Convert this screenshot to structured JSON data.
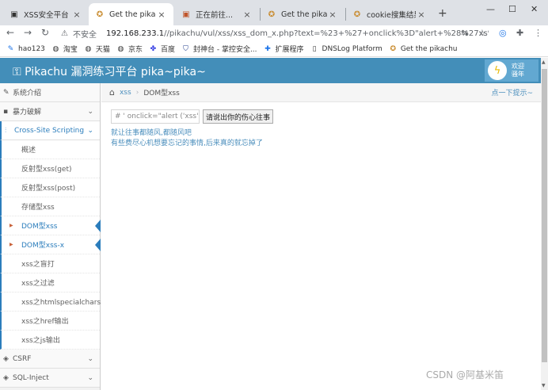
{
  "browser": {
    "tabs": [
      {
        "title": "XSS安全平台",
        "icon": "page-icon"
      },
      {
        "title": "Get the pikachu",
        "icon": "pikachu-icon"
      },
      {
        "title": "正在前往...",
        "icon": "page-icon"
      },
      {
        "title": "Get the pikachu",
        "icon": "pikachu-icon"
      },
      {
        "title": "cookie搜集结果",
        "icon": "cookie-icon"
      }
    ],
    "active_tab": 1,
    "address": {
      "security": "不安全",
      "host": "192.168.233.1",
      "path": "//pikachu/vul/xss/xss_dom_x.php?text=%23+%27+onclick%3D\"alert+%28%27xs%..."
    },
    "bookmarks": [
      {
        "label": "hao123",
        "icon": "hao123-icon"
      },
      {
        "label": "淘宝",
        "icon": "globe-icon"
      },
      {
        "label": "天猫",
        "icon": "globe-icon"
      },
      {
        "label": "京东",
        "icon": "globe-icon"
      },
      {
        "label": "百度",
        "icon": "baidu-icon"
      },
      {
        "label": "封神台 - 掌控安全...",
        "icon": "shield-icon"
      },
      {
        "label": "扩展程序",
        "icon": "puzzle-icon"
      },
      {
        "label": "DNSLog Platform",
        "icon": "page-icon"
      },
      {
        "label": "Get the pikachu",
        "icon": "pikachu-icon"
      }
    ]
  },
  "site": {
    "logo": "Pikachu 漏洞练习平台 pika~pika~",
    "user_greeting_1": "欢迎",
    "user_greeting_2": "骚年"
  },
  "sidebar": {
    "top_items": [
      {
        "label": "系统介绍",
        "icon": "tag-icon"
      },
      {
        "label": "暴力破解",
        "icon": "lock-icon"
      }
    ],
    "open_section": {
      "label": "Cross-Site Scripting",
      "icon": "tree-icon"
    },
    "sub_items": [
      {
        "label": "概述",
        "active": false
      },
      {
        "label": "反射型xss(get)",
        "active": false
      },
      {
        "label": "反射型xss(post)",
        "active": false
      },
      {
        "label": "存储型xss",
        "active": false
      },
      {
        "label": "DOM型xss",
        "active": true
      },
      {
        "label": "DOM型xss-x",
        "active": true
      },
      {
        "label": "xss之盲打",
        "active": false
      },
      {
        "label": "xss之过滤",
        "active": false
      },
      {
        "label": "xss之htmlspecialchars",
        "active": false
      },
      {
        "label": "xss之href输出",
        "active": false
      },
      {
        "label": "xss之js输出",
        "active": false
      }
    ],
    "bottom_items": [
      {
        "label": "CSRF",
        "icon": "csrf-icon"
      },
      {
        "label": "SQL-Inject",
        "icon": "database-icon"
      }
    ]
  },
  "breadcrumb": {
    "link": "xss",
    "current": "DOM型xss",
    "tip": "点一下提示~"
  },
  "content": {
    "input_value": "# ' onclick=\"alert ('xss')\">",
    "button_label": "请说出你的伤心往事",
    "message_1": "就让往事都随风,都随风吧",
    "message_2": "有些费尽心机想要忘记的事情,后来真的就忘掉了"
  },
  "watermark": "CSDN @阿基米笛",
  "colors": {
    "header": "#438eb9",
    "link": "#4c8fbd",
    "sidebar_active": "#2b7dbc"
  }
}
